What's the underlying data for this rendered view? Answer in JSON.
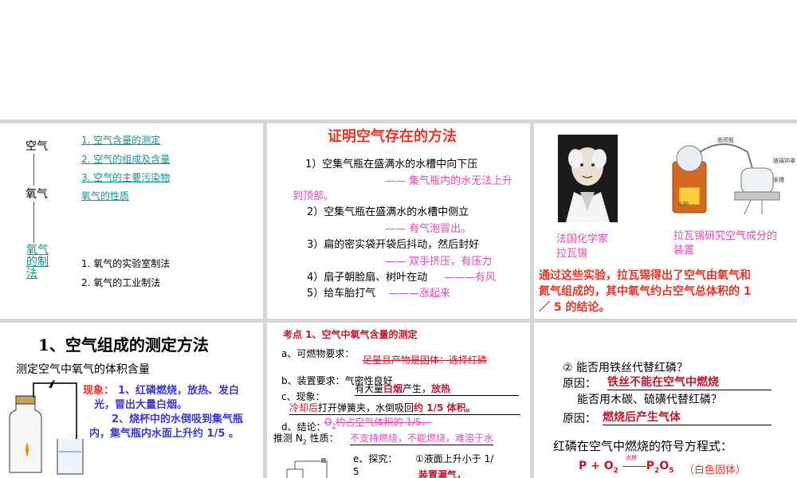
{
  "slide1": {
    "chain": [
      "空气",
      "氧气",
      "氧气的制法"
    ],
    "topics_a": [
      "1. 空气含量的测定",
      "2. 空气的组成及含量",
      "3. 空气的主要污染物",
      "氧气的性质"
    ],
    "topics_b": [
      "1. 氧气的实验室制法",
      "2. 氧气的工业制法"
    ]
  },
  "slide2": {
    "title": "证明空气存在的方法",
    "item1": "1）空集气瓶在盛满水的水槽中向下压",
    "item1_result": "—— 集气瓶内的水无法上升",
    "item1_result_cont": "到顶部。",
    "item2": "2）空集气瓶在盛满水的水槽中侧立",
    "item2_result": "—— 有气泡冒出。",
    "item3": "3）扁的密实袋开袋后抖动，然后封好",
    "item3_result": "—— 双手挤压，有压力",
    "item4": "4）扇子朝脸扇、树叶在动",
    "item4_result": "———有风",
    "item5": "5）给车胎打气",
    "item5_result": "———涨起来"
  },
  "slide3": {
    "portrait_caption": [
      "法国化学家",
      "拉瓦锡"
    ],
    "apparatus_caption": [
      "拉瓦锡研究空气成分的",
      "装置"
    ],
    "apparatus_labels": [
      "曲颈瓶",
      "玻璃钟罩",
      "汞槽",
      "火炉"
    ],
    "conclusion": [
      "通过这些实验，拉瓦锡得出了空气由氧气和",
      "氮气组成的，其中氧气约占空气总体积的 1",
      "／ 5 的结论。"
    ]
  },
  "slide4": {
    "title": "1、空气组成的测定方法",
    "subtitle": "测定空气中氧气的体积含量",
    "phen_label": "现象：",
    "phen_1": "1、红磷燃烧，放热、发白",
    "phen_1b": "光，冒出大量白烟。",
    "phen_2": "2、烧杯中的水倒吸到集气瓶",
    "phen_2b": "内，集气瓶内水面上升约 1/5 。"
  },
  "slide5": {
    "title": "考点 1、空气中氧气含量的测定",
    "a": "a、可燃物要求：",
    "a_ans": "足量且产物是固体：选择红磷",
    "b": "b、装置要求：气密性良好",
    "c": "c、现象：",
    "c_ans_1": "有大量",
    "c_ans_2": "白烟",
    "c_ans_3": "产生，",
    "c_ans_4": "放热",
    "c_line2_a": "冷却后",
    "c_line2_b": "打开弹簧夹，水倒吸回",
    "c_line2_c": "约 1/5 体积。",
    "d": "d、结论：",
    "d_ans_o2": "O",
    "d_ans_o2_sub": "2",
    "d_ans": "约占空气体积的 1/5，",
    "n2_a": "推测 N",
    "n2_sub": "2",
    "n2_b": " 性质：",
    "n2_ans": "不支持燃烧，不能燃烧，难溶于水",
    "e": "e、探究：",
    "e_1": "①液面上升小于 1/",
    "e_1b": "5",
    "e_1c": "装置漏气，"
  },
  "slide6": {
    "q2": "② 能否用铁丝代替红磷？",
    "reason_label": "原因：",
    "reason_1": "铁丝不能在空气中燃烧",
    "q3": "能否用木碳、硫磺代替红磷？",
    "reason_2": "燃烧后产生气体",
    "eq_title": "红磷在空气中燃烧的符号方程式：",
    "eq_left": "P + O",
    "eq_o_sub": "2",
    "eq_cond": "点燃",
    "eq_right": "P",
    "eq_p_sub": "2",
    "eq_right2": "O",
    "eq_o5_sub": "5",
    "eq_note": "（白色固体）"
  }
}
